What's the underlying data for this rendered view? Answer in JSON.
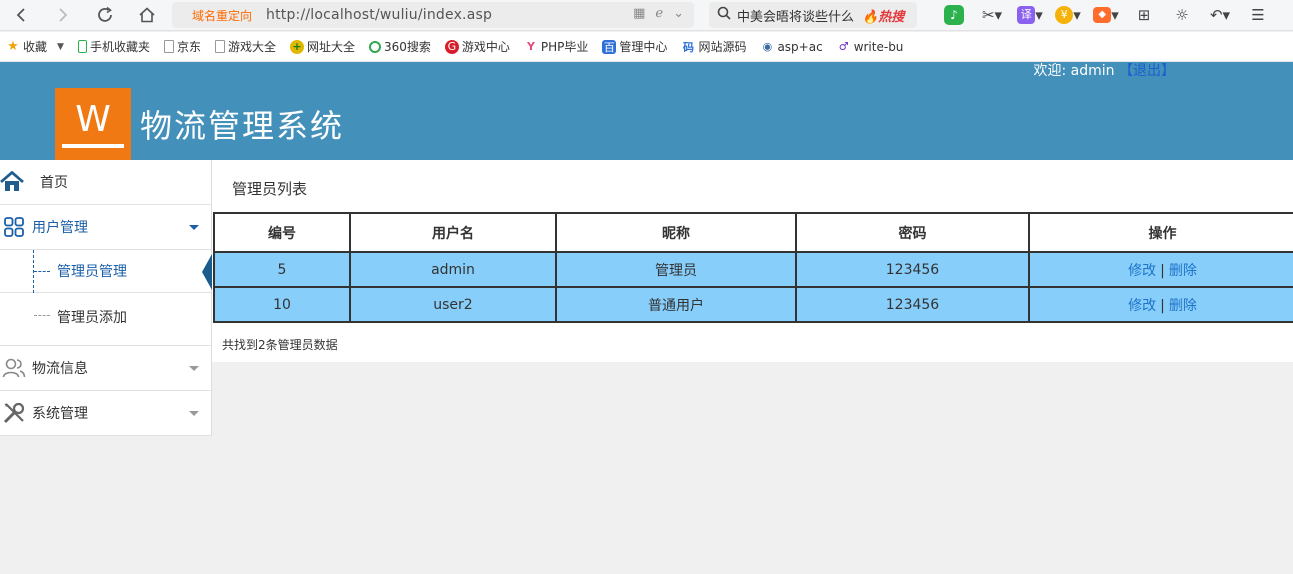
{
  "browser": {
    "redirect_label": "域名重定向",
    "url": "http://localhost/wuliu/index.asp",
    "search_text": "中美会晤将谈些什么",
    "hot_label": "热搜",
    "tools": [
      "qq-music-icon",
      "scissors-icon",
      "translate-icon",
      "wallet-icon",
      "game-icon",
      "apps-icon",
      "brightness-icon",
      "undo-icon",
      "menu-icon"
    ],
    "translate_glyph": "译",
    "wallet_glyph": "¥"
  },
  "bookmarks": [
    {
      "label": "收藏",
      "icon": "star-icon"
    },
    {
      "label": "手机收藏夹",
      "icon": "phone-icon"
    },
    {
      "label": "京东",
      "icon": "page-icon"
    },
    {
      "label": "游戏大全",
      "icon": "page-icon"
    },
    {
      "label": "网址大全",
      "icon": "globe-icon"
    },
    {
      "label": "360搜索",
      "icon": "search-360-icon"
    },
    {
      "label": "游戏中心",
      "icon": "game-center-icon"
    },
    {
      "label": "PHP毕业",
      "icon": "php-icon"
    },
    {
      "label": "管理中心",
      "icon": "admin-center-icon"
    },
    {
      "label": "网站源码",
      "icon": "source-code-icon"
    },
    {
      "label": "asp+ac",
      "icon": "asp-icon"
    },
    {
      "label": "write-bu",
      "icon": "write-icon"
    }
  ],
  "header": {
    "logo_letter": "W",
    "title": "物流管理系统",
    "welcome_prefix": "欢迎:",
    "username": "admin",
    "logout": "【退出】"
  },
  "sidebar": {
    "home": "首页",
    "user_mgmt": "用户管理",
    "sub_admin_mgmt": "管理员管理",
    "sub_admin_add": "管理员添加",
    "logistics": "物流信息",
    "system": "系统管理"
  },
  "main": {
    "title": "管理员列表",
    "columns": [
      "编号",
      "用户名",
      "昵称",
      "密码",
      "操作"
    ],
    "rows": [
      {
        "id": "5",
        "username": "admin",
        "nickname": "管理员",
        "password": "123456",
        "edit": "修改",
        "delete": "删除"
      },
      {
        "id": "10",
        "username": "user2",
        "nickname": "普通用户",
        "password": "123456",
        "edit": "修改",
        "delete": "删除"
      }
    ],
    "separator": "|",
    "summary": "共找到2条管理员数据"
  },
  "colors": {
    "header_bg": "#4390bb",
    "logo_bg": "#f07914",
    "row_bg": "#87cefa",
    "link": "#1e73c8",
    "active": "#1a5fa8"
  }
}
